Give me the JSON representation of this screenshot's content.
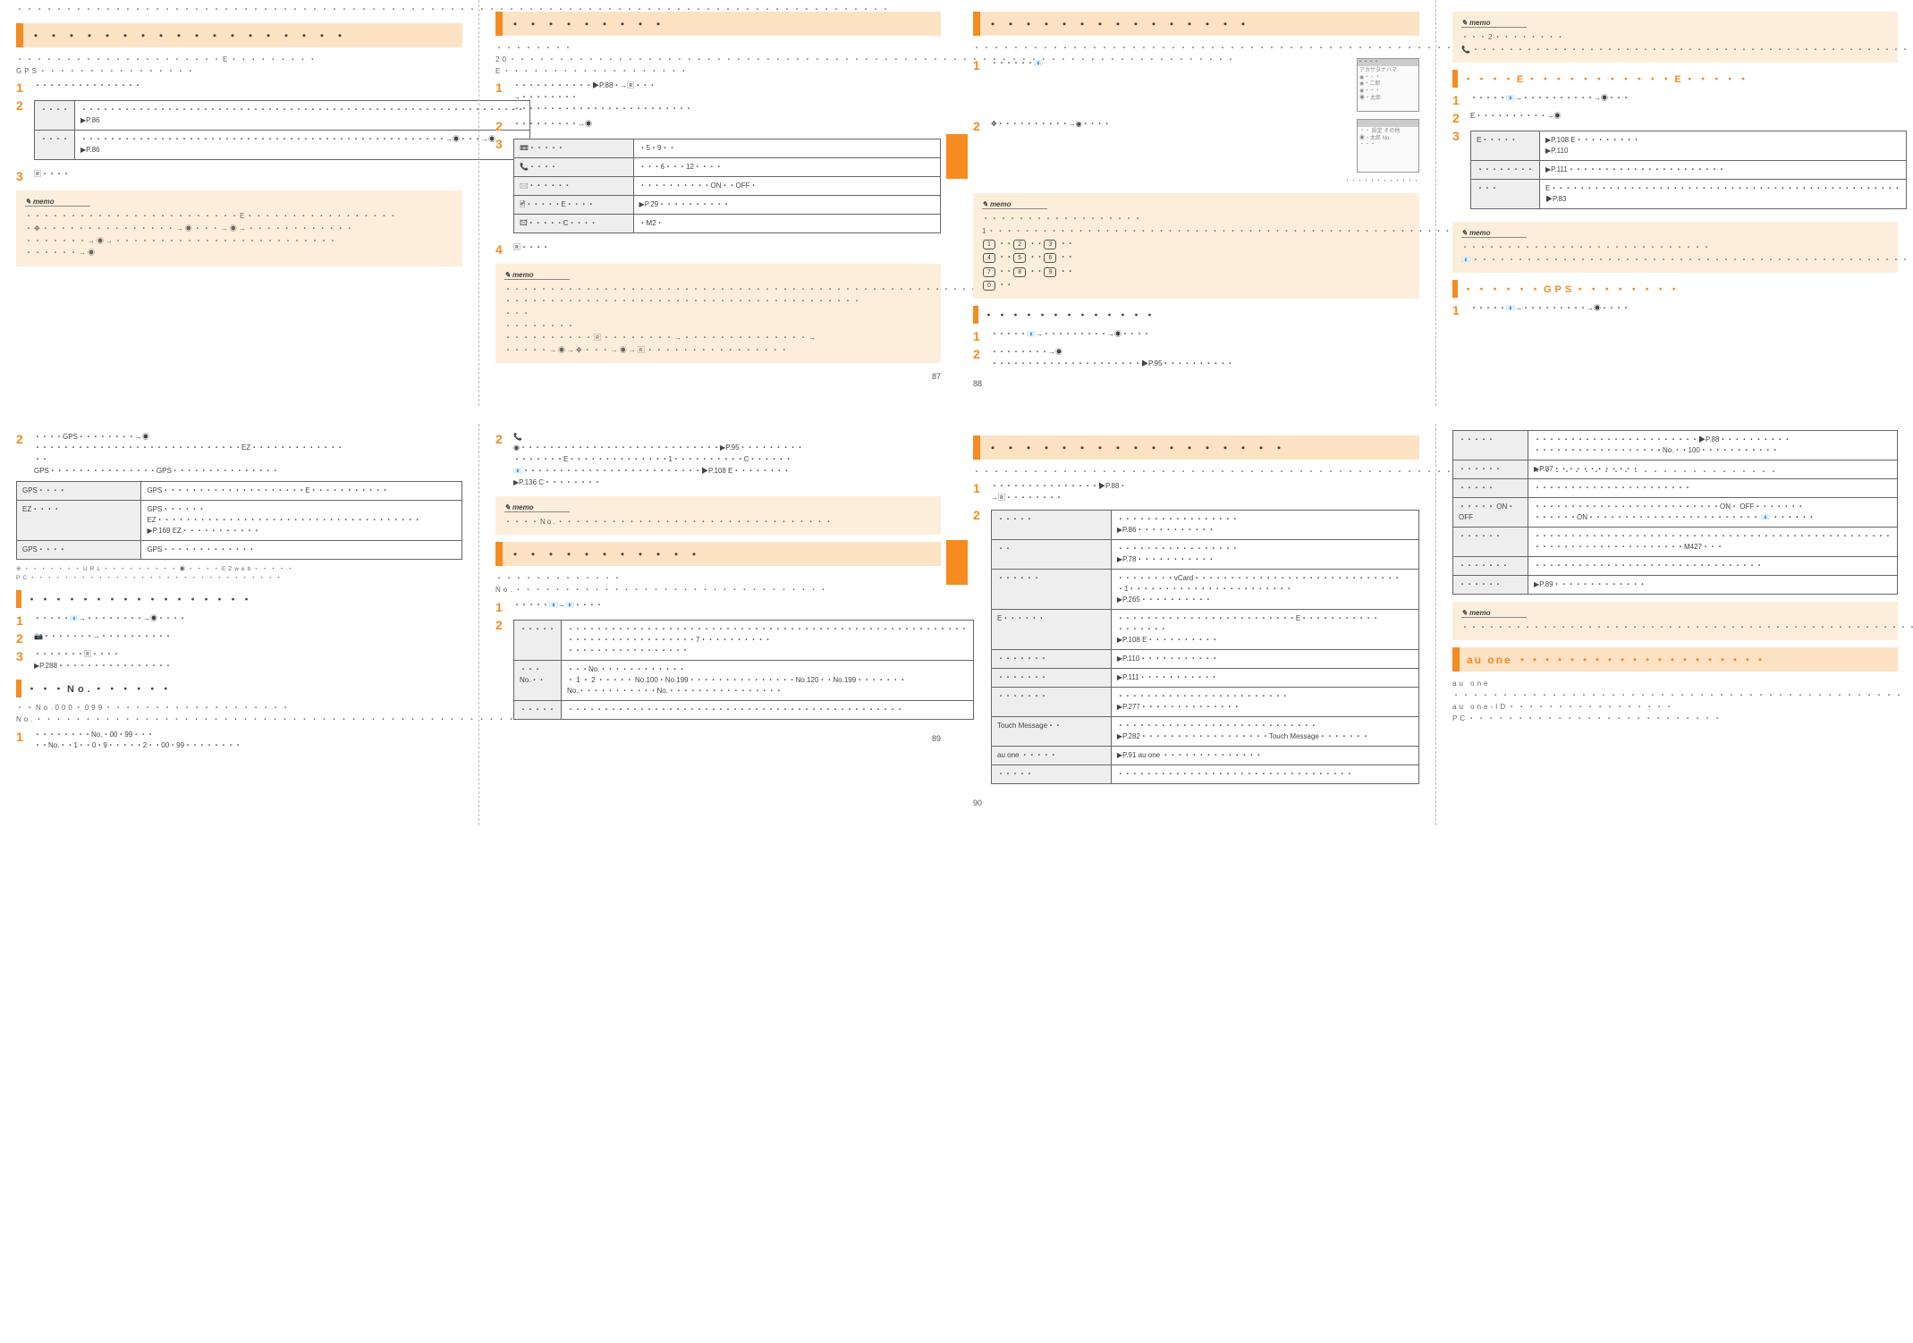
{
  "memo_label": "memo",
  "sp1": {
    "p87": {
      "intro": "・・・・・・・・・・・・・・・・・・・・・・・・・・・・・・・・・・・・・・・・・・・・・・・・・・・・・・・・・・・・・・・・・・・・・・・・・・・・・・・・・・・・・・・・・",
      "h1": "・・・・・・・・・・・・・・・・・・",
      "body1": "・・・・・・・・・・・・・・・・・・・・・E・・・・・・・・・GPS・・・・・・・・・・・・・・・・",
      "s1": "・・・・・・・・・・・・・・・",
      "t_r1c2": "・・・・・・・・・・・・・・・・・・・・・・・・・・・・・・・・・・・・・・・・・・・・・・・・・・・・・・・・・・・・・・\n▶P.86",
      "t_r2c2": "・・・・・・・・・・・・・・・・・・・・・・・・・・・・・・・・・・・・・・・・・・・・・・・・・・・→◉・・・→◉\n▶P.86",
      "s3": "🅁・・・・",
      "m1": "・・・・・・・・・・・・・・・・・・・・・・・・E・・・・・・・・・・・・・・・・・\n・✥・・・・・・・・・・・・・・・→◉・・・→◉→・・・・・・・・・・・・\n・・・・・・・→◉→・・・・・・・・・・・・・・・・・・・・・・・・・\n・・・・・・→◉"
    },
    "p88": {
      "h1": "・・・・・・・・・",
      "body1": "・・・・・・・・20・・・・・・・・・・・・・・・・・・・・・・・・・・・・・・・・・・・・・・・・・・・・・・・・・・・・・・・・・・・・・・・・・・・・・・・・・・E・・・・・・・・・・・・・・・・・・・",
      "s1": "・・・・・・・・・・・▶P.88・→🅁・・・\n→・・・・・・・・\n・・・・・・・・・・・・・・・・・・・・・・・・・",
      "s2": "・・・・・・・・・→◉",
      "t_rows": [
        [
          "📼・・・・・",
          "・5・9・・"
        ],
        [
          "📞・・・・",
          "・・・6・・・12・・・・"
        ],
        [
          "🖂・・・・・・",
          "・・・・・・・・・・ON・・OFF・"
        ],
        [
          "🖻・・・・・E・・・・",
          "▶P.29・・・・・・・・・・"
        ],
        [
          "🖾・・・・・C・・・・",
          "・M2・"
        ]
      ],
      "s4": "🅁・・・・",
      "m1": "・・・・・・・・・・・・・・・・・・・・・・・・・・・・・・・・・・・・・・・・・・・・・・・・・・・・・・・・・・・・・・・・・・・・・・・・・・・\n・・・・・・・・・・・・・・・・・・・・・・・・・・・・・・・・・・・・・・・・\n・・・\n・・・・・・・・\n・・・・・・・・・・🅁・・・・・・・・→・・・・・・・・・・・・・・→\n・・・・・→◉→✥・・・→◉→🅁・・・・・・・・・・・・・・・・",
      "pgn": "87"
    },
    "p89": {
      "h1": "・・・・・・・・・・・・・・・",
      "body1": "・・・・・・・・・・・・・・・・・・・・・・・・・・・・・・・・・・・・・・・・・・・・・・・・・・・・・",
      "s1a": "・・・・・・📧",
      "screen1_title": "・・・・",
      "screen1_rows": "アカサタナハマ\n◉・・・\n◉・二郎\n◉・・・\n◉・太郎",
      "s2": "✥・・・・・・・・・・→◉・・・・",
      "screen2_rows": "・・  設定  その他\n◉・太郎      No.\n                  ・・・",
      "caption": "・・・・・・・・・・・・",
      "m1": "・・・・・・・・・・・・・・・・・・1・・・・・・・・・・・・・・・・・・・・・・・・・・・・・・・・・・・・・・・・・・・・・・・・・・・・・・・・・・・・・・・・",
      "keys": [
        [
          "1",
          "2",
          "3"
        ],
        [
          "4",
          "5",
          "6"
        ],
        [
          "7",
          "8",
          "9"
        ],
        [
          "",
          "0",
          ""
        ]
      ],
      "sub1": "・・・・・・・・・・・・・",
      "sub_s1": "・・・・・📧→・・・・・・・・・→◉・・・・",
      "sub_s2": "・・・・・・・・→◉\n・・・・・・・・・・・・・・・・・・・・・▶P.95・・・・・・・・・・",
      "pgn": "88"
    },
    "p90": {
      "m1": "・・・2・・・・・・・・📞・・・・・・・・・・・・・・・・・・・・・・・・・・・・・・・・・・・・・・・・・・・・・・・・・・・・・・・・・・・・・・・・・・・・・・・・・・・・・・・・・・・・・・・・・・・・・・・・・・・・・・・・・・・・・・・",
      "sub1_a": "・・・・E・・・・・・・・・・・E・・・・・",
      "s1": "・・・・・📧→・・・・・・・・・・→◉・・・",
      "s2": "E・・・・・・・・・・→◉",
      "t_rows": [
        [
          "E・・・・・",
          "▶P.108 E・・・・・・・・・\n▶P.110"
        ],
        [
          "・・・・・・・・",
          "▶P.111・・・・・・・・・・・・・・・・・・・・・・"
        ],
        [
          "・・・",
          "E・・・・・・・・・・・・・・・・・・・・・・・・・・・・・・・・・・・・・・・・・・・・・・・・・▶P.83"
        ]
      ],
      "m2": "・・・・・・・・・・・・・・・・・・・・・・・・・・・・📧・・・・・・・・・・・・・・・・・・・・・・・・・・・・・・・・・・・・・・・・・・・・・・・・・・・・・・・",
      "sub2": "・・・・・・GPS・・・・・・・・",
      "sub2_s1": "・・・・・📧→・・・・・・・・・→◉・・・・"
    }
  },
  "sp2": {
    "p89": {
      "s2": "・・・・GPS・・・・・・・・→◉\n・・・・・・・・・・・・・・・・・・・・・・・・・・・・・EZ・・・・・・・・・・・・・\n・・\nGPS・・・・・・・・・・・・・・・GPS・・・・・・・・・・・・・・・",
      "t_rows": [
        [
          "GPS・・・・",
          "GPS・・・・・・・・・・・・・・・・・・・・E・・・・・・・・・・・"
        ],
        [
          "EZ・・・・",
          "GPS・・・・・・EZ・・・・・・・・・・・・・・・・・・・・・・・・・・・・・・・・・・・・・\n▶P.169 EZ・・・・・・・・・・・"
        ],
        [
          "GPS・・・・",
          "GPS・・・・・・・・・・・・・"
        ]
      ],
      "foot": "※・・・・・・・URL・・・・・・・・・◉・・・・EZweb・・・・・PC・・・・・・・・・・・・・・・・・・・・・・・・・・・・・・",
      "sub1": "・・・・・・・・・・・・・・・・・",
      "sub_s1": "・・・・・📧→・・・・・・・・→◉・・・・",
      "sub_s2": "📷・・・・・・・→・・・・・・・・・・",
      "sub_s3": "・・・・・・・🅁・・・・\n▶P.288・・・・・・・・・・・・・・・・",
      "sub2": "・・・No.・・・・・・",
      "sub2_body": "・・No.000・099・・・・・・・・・・・・・・・・・・・No.・・・・・・・・・・・・・・・・・・・・・・・・・・・・・・・・・・・・・・・・・・・・・・・・・・・",
      "sub2_s1": "・・・・・・・・No.・00・99・・・\n・・No.・・1・・0・9・・・・・2・・00・99・・・・・・・・"
    },
    "p90": {
      "s2top": "📞",
      "s2body": "◉・・・・・・・・・・・・・・・・・・・・・・・・・・・・▶P.95・・・・・・・・・\n・・・・・・・E・・・・・・・・・・・・・・1・・・・・・・・・・C・・・・・・   📧・・・・・・・・・・・・・・・・・・・・・・・・・▶P.108 E・・・・・・・・\n▶P.136 C・・・・・・・・",
      "m1": "・・・・No.・・・・・・・・・・・・・・・・・・・・・・・・・・・・・・・",
      "h1": "・・・・・・・・・・・",
      "h1body": "・・・・・・・・・・・・・No.・・・・・・・・・・・・・・・・・・・・・・・・・・・・・・・・",
      "s1": "・・・・・📧→📧・・・・",
      "t_rows": [
        [
          "・・・・・",
          "・・・・・・・・・・・・・・・・・・・・・・・・・・・・・・・・・・・・・・・・・・・・・・・・・・・・・・・・\n・・・・・・・・・・・・・・・・・・7・・・・・・・・・・\n・・・・・・・・・・・・・・・・・"
        ],
        [
          "・・・No.・・",
          "・・・No.・・・・・・・・・・・・\n・ 1 ・ 2 ・・・・・ No.100・No.199・・・・・・・・・・・・・・・No.120・・No.199・・・・・・・\n  No.・・・・・・・・・・・No.・・・・・・・・・・・・・・・・"
        ],
        [
          "・・・・・",
          "・・・・・・・・・・・・・・・・・・・・・・・・・・・・・・・・・・・・・・・・・・・・・・・"
        ]
      ],
      "pgn": "89"
    },
    "p91": {
      "h1": "・・・・・・・・・・・・・・・・・",
      "h1body": "・・・・・・・・・・・・・・・・・・・・・・・・・・・・・・・・・・・・・・・・・・・・・・・・・・・・・・・・・・・・・・・・・・・・・・・・・・・・・・・・・・",
      "s1": "・・・・・・・・・・・・・・・▶P.88・\n→🅁・・・・・・・・",
      "t_rows": [
        [
          "・・・・・",
          "・・・・・・・・・・・・・・・・・\n▶P.86・・・・・・・・・・・"
        ],
        [
          "・・",
          "・・・・・・・・・・・・・・・・・\n▶P.78・・・・・・・・・・・"
        ],
        [
          "・・・・・・",
          "・・・・・・・・vCard・・・・・・・・・・・・・・・・・・・・・・・・・・・・・\n・1・・・・・・・・・・・・・・・・・・・・・・・\n▶P.265・・・・・・・・・・"
        ],
        [
          "E・・・・・・",
          "・・・・・・・・・・・・・・・・・・・・・・・・・E・・・・・・・・・・・\n・・・・・・・\n▶P.108 E・・・・・・・・・・"
        ],
        [
          "・・・・・・・",
          "▶P.110・・・・・・・・・・・"
        ],
        [
          "・・・・・・・",
          "▶P.111・・・・・・・・・・・"
        ],
        [
          "・・・・・・・",
          "・・・・・・・・・・・・・・・・・・・・・・・・\n▶P.277・・・・・・・・・・・・・・"
        ],
        [
          "Touch Message・・",
          "・・・・・・・・・・・・・・・・・・・・・・・・・・・・\n▶P.282・・・・・・・・・・・・・・・・・・Touch Message・・・・・・・"
        ],
        [
          "au one ・・・・・",
          "▶P.91 au one ・・・・・・・・・・・・・・"
        ],
        [
          "・・・・・",
          "・・・・・・・・・・・・・・・・・・・・・・・・・・・・・・・・・"
        ]
      ],
      "pgn": "90"
    },
    "p92": {
      "t_rows": [
        [
          "・・・・・",
          "・・・・・・・・・・・・・・・・・・・・・・・▶P.88・・・・・・・・・・\n・・・・・・・・・・・・・・・・・・No.・・100・・・・・・・・・・・"
        ],
        [
          "・・・・・・",
          "▶P.87・・・・・・・・・・・・"
        ],
        [
          "・・・・・",
          "・・・・・・・・・・・・・・・・・・・・・・"
        ],
        [
          "・・・・・ ON・OFF",
          "・・・・・・・・・・・・・・・・・・・・・・・・・・ON・ OFF・・・・・・・\n・・・・・・ON・・・・・・・・・・・・・・・・・・・・・・・・ 📧 ・・・・・・"
        ],
        [
          "・・・・・・",
          "・・・・・・・・・・・・・・・・・・・・・・・・・・・・・・・・・・・・・・・・・・・・・・・・・・\n・・・・・・・・・・・・・・・・・・・・・M427・・・"
        ],
        [
          "・・・・・・・",
          "・・・・・・・・・・・・・・・・・・・・・・・・・・・・・・・・"
        ],
        [
          "・・・・・・",
          "▶P.89・・・・・・・・・・・・・"
        ]
      ],
      "m1": "・・・・・・・・・・・・・・・・・・・・・・・・・・・・・・・・・・・・・・・・・・・・・・・・・・・・・・・・・・・・・・・・・・・・・・・・・・・・・・・",
      "h1": "au one ・・・・・・・・・・・・・・・・・・・・",
      "h1body": "au one ・・・・・・・・・・・・・・・・・・・・・・・・・・・・・・・・・・・・・・・・・・・・・・\nau one-ID・・・・・・・・・・・・・・・・・PC・・・・・・・・・・・・・・・・・・・・・・・・・・"
    }
  }
}
